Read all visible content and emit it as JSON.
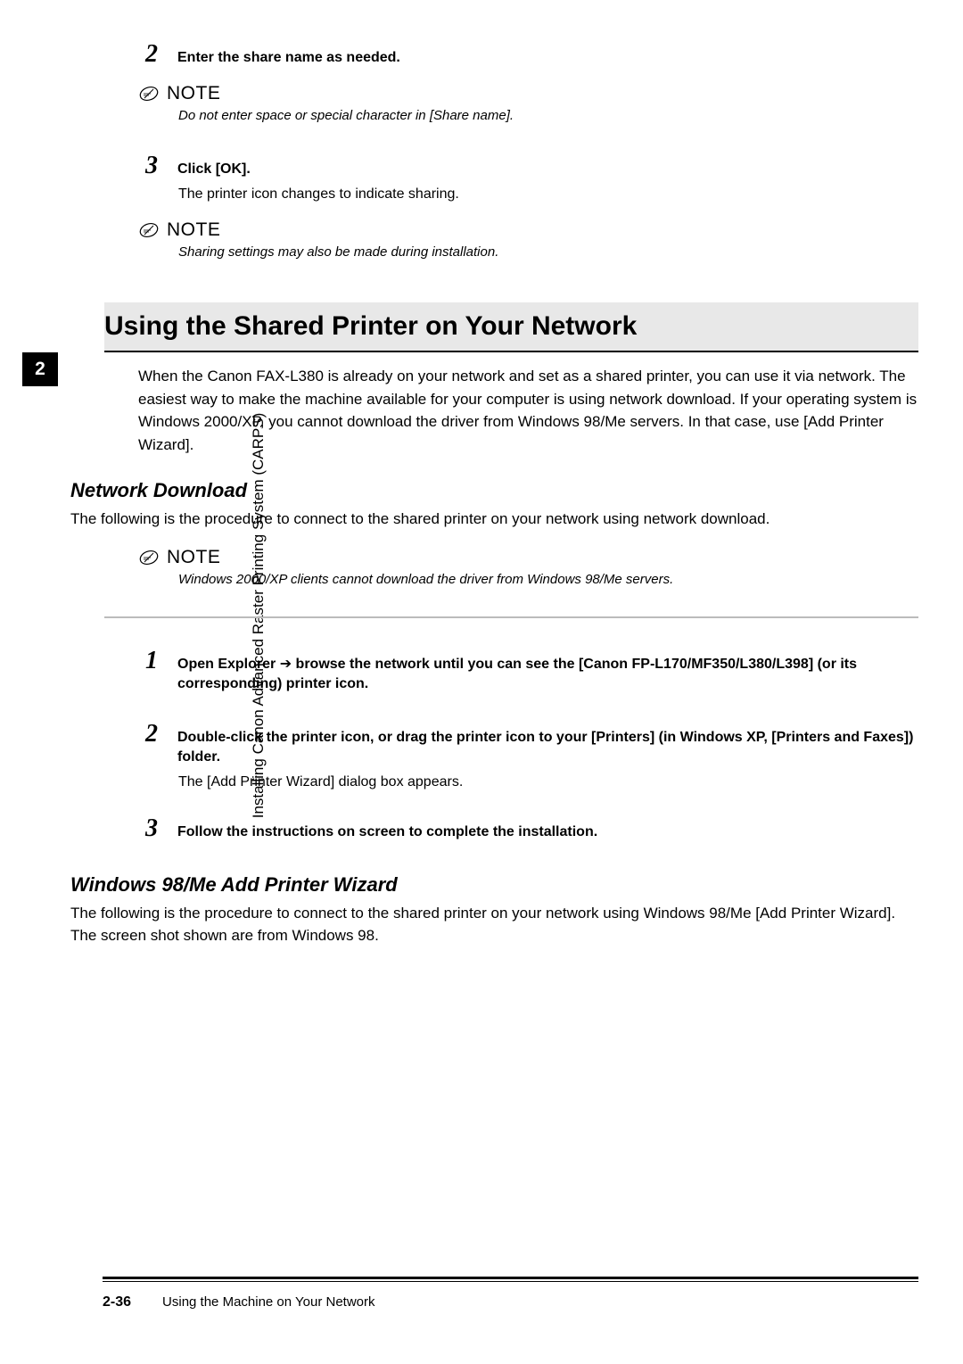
{
  "chapter": {
    "number": "2",
    "sideLabel": "Installing Canon Advanced Raster Printing System (CARPS)"
  },
  "topSteps": {
    "s2": {
      "num": "2",
      "text": "Enter the share name as needed."
    },
    "note1": {
      "label": "NOTE",
      "text": "Do not enter space or special character in [Share name]."
    },
    "s3": {
      "num": "3",
      "text": "Click [OK].",
      "body": "The printer icon changes to indicate sharing."
    },
    "note2": {
      "label": "NOTE",
      "text": "Sharing settings may also be made during installation."
    }
  },
  "section": {
    "heading": "Using the Shared Printer on Your Network",
    "intro": "When the Canon FAX-L380 is already on your network and set as a shared printer, you can use it via network. The easiest way to make the machine available for your computer is using network download. If your operating system is Windows 2000/XP, you cannot download the driver from Windows 98/Me servers. In that case, use [Add Printer Wizard]."
  },
  "networkDownload": {
    "heading": "Network Download",
    "intro": "The following is the procedure to connect to the shared printer on your network using network download.",
    "note": {
      "label": "NOTE",
      "text": "Windows 2000/XP clients cannot download the driver from Windows 98/Me servers."
    },
    "s1": {
      "num": "1",
      "pre": "Open Explorer ",
      "post": " browse the network until you can see the [Canon FP-L170/MF350/L380/L398] (or its corresponding) printer icon."
    },
    "s2": {
      "num": "2",
      "text": "Double-click the printer icon, or drag the printer icon to your [Printers] (in Windows XP, [Printers and Faxes]) folder.",
      "body": "The [Add Printer Wizard] dialog box appears."
    },
    "s3": {
      "num": "3",
      "text": "Follow the instructions on screen to complete the installation."
    }
  },
  "win98": {
    "heading": "Windows 98/Me Add Printer Wizard",
    "intro": "The following is the procedure to connect to the shared printer on your network using Windows 98/Me [Add Printer Wizard]. The screen shot shown are from Windows 98."
  },
  "footer": {
    "page": "2-36",
    "text": "Using the Machine on Your Network"
  }
}
